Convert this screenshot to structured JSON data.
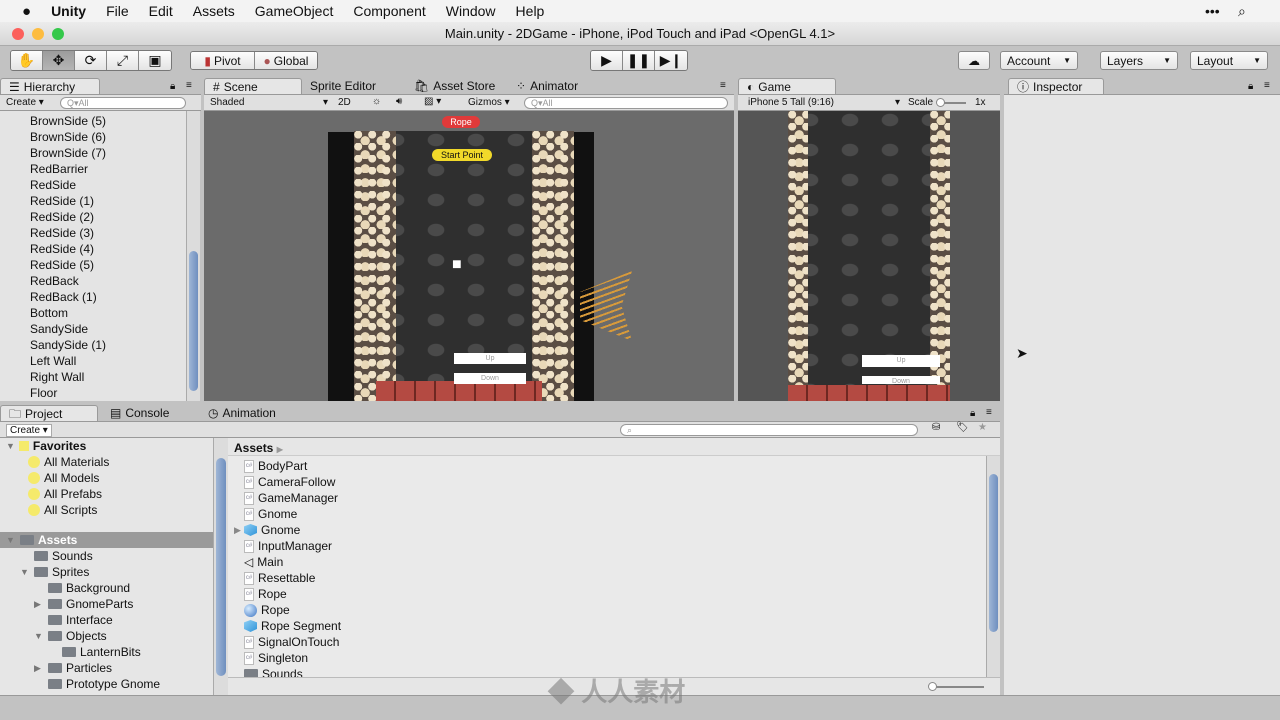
{
  "menubar": {
    "apple": "",
    "app": "Unity",
    "items": [
      "File",
      "Edit",
      "Assets",
      "GameObject",
      "Component",
      "Window",
      "Help"
    ]
  },
  "window": {
    "title": "Main.unity - 2DGame - iPhone, iPod Touch and iPad <OpenGL 4.1>"
  },
  "toolbar": {
    "pivot": "Pivot",
    "global": "Global",
    "account": "Account",
    "layers": "Layers",
    "layout": "Layout"
  },
  "hierarchy": {
    "tab": "Hierarchy",
    "create": "Create",
    "search_placeholder": "Q▾All",
    "items": [
      "BrownSide (5)",
      "BrownSide (6)",
      "BrownSide (7)",
      "RedBarrier",
      "RedSide",
      "RedSide (1)",
      "RedSide (2)",
      "RedSide (3)",
      "RedSide (4)",
      "RedSide (5)",
      "RedBack",
      "RedBack (1)",
      "Bottom",
      "SandySide",
      "SandySide (1)",
      "Left Wall",
      "Right Wall",
      "Floor"
    ]
  },
  "scene": {
    "tabs": [
      "Scene",
      "Sprite Editor",
      "Asset Store",
      "Animator"
    ],
    "shading": "Shaded",
    "mode_2d": "2D",
    "gizmos": "Gizmos",
    "search_placeholder": "Q▾All",
    "labels": {
      "rope": "Rope",
      "start_point": "Start Point",
      "up": "Up",
      "down": "Down"
    }
  },
  "game": {
    "tab": "Game",
    "aspect": "iPhone 5 Tall (9:16)",
    "scale_label": "Scale",
    "scale_value": "1x",
    "buttons": {
      "up": "Up",
      "down": "Down"
    }
  },
  "inspector": {
    "tab": "Inspector"
  },
  "project": {
    "tabs": [
      "Project",
      "Console",
      "Animation"
    ],
    "create": "Create",
    "favorites": {
      "label": "Favorites",
      "items": [
        "All Materials",
        "All Models",
        "All Prefabs",
        "All Scripts"
      ]
    },
    "tree": [
      {
        "label": "Assets",
        "depth": 0,
        "arrow": "down",
        "selected": true
      },
      {
        "label": "Sounds",
        "depth": 1,
        "arrow": ""
      },
      {
        "label": "Sprites",
        "depth": 1,
        "arrow": "down"
      },
      {
        "label": "Background",
        "depth": 2,
        "arrow": ""
      },
      {
        "label": "GnomeParts",
        "depth": 2,
        "arrow": "right"
      },
      {
        "label": "Interface",
        "depth": 2,
        "arrow": ""
      },
      {
        "label": "Objects",
        "depth": 2,
        "arrow": "down"
      },
      {
        "label": "LanternBits",
        "depth": 3,
        "arrow": ""
      },
      {
        "label": "Particles",
        "depth": 2,
        "arrow": "right"
      },
      {
        "label": "Prototype Gnome",
        "depth": 2,
        "arrow": ""
      }
    ],
    "breadcrumb": "Assets",
    "assets": [
      {
        "label": "BodyPart",
        "icon": "script"
      },
      {
        "label": "CameraFollow",
        "icon": "script"
      },
      {
        "label": "GameManager",
        "icon": "script"
      },
      {
        "label": "Gnome",
        "icon": "script"
      },
      {
        "label": "Gnome",
        "icon": "prefab"
      },
      {
        "label": "InputManager",
        "icon": "script"
      },
      {
        "label": "Main",
        "icon": "unity-scene"
      },
      {
        "label": "Resettable",
        "icon": "script"
      },
      {
        "label": "Rope",
        "icon": "script"
      },
      {
        "label": "Rope",
        "icon": "material"
      },
      {
        "label": "Rope Segment",
        "icon": "prefab"
      },
      {
        "label": "SignalOnTouch",
        "icon": "script"
      },
      {
        "label": "Singleton",
        "icon": "script"
      },
      {
        "label": "Sounds",
        "icon": "folder"
      }
    ]
  },
  "watermark": "人人素材"
}
